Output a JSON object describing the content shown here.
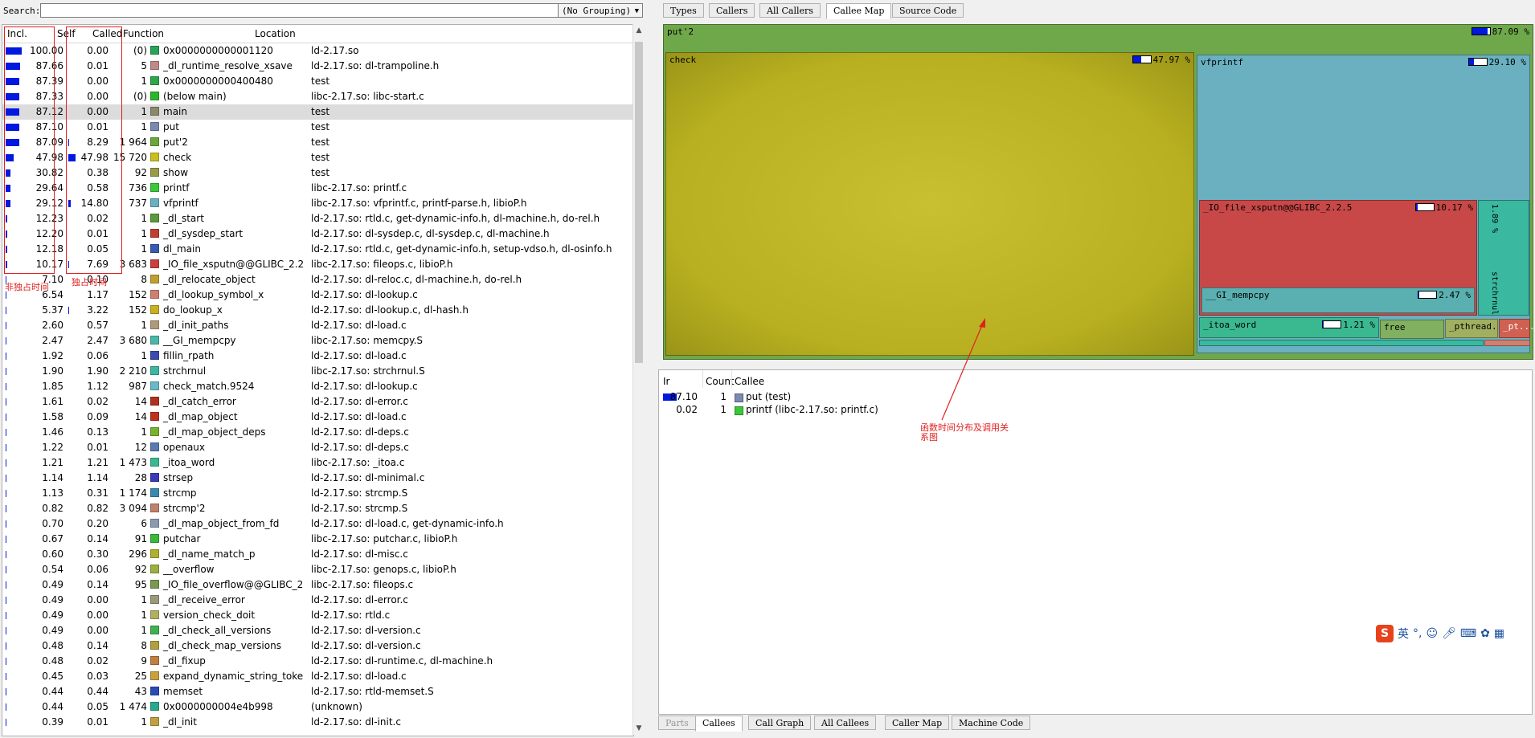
{
  "search": {
    "label": "Search:",
    "value": "",
    "grouping": "(No Grouping)"
  },
  "columns": {
    "incl": "Incl.",
    "self": "Self",
    "called": "Called",
    "function": "Function",
    "location": "Location"
  },
  "rows": [
    {
      "incl": "100.00",
      "self": "0.00",
      "called": "(0)",
      "fn": "0x0000000000001120",
      "loc": "ld-2.17.so",
      "color": "#27a35a"
    },
    {
      "incl": "87.66",
      "self": "0.01",
      "called": "5",
      "fn": "_dl_runtime_resolve_xsave",
      "loc": "ld-2.17.so: dl-trampoline.h",
      "color": "#c08a8a"
    },
    {
      "incl": "87.39",
      "self": "0.00",
      "called": "1",
      "fn": "0x0000000000400480",
      "loc": "test",
      "color": "#2aa84a"
    },
    {
      "incl": "87.33",
      "self": "0.00",
      "called": "(0)",
      "fn": "(below main)",
      "loc": "libc-2.17.so: libc-start.c",
      "color": "#2ab82a"
    },
    {
      "incl": "87.12",
      "self": "0.00",
      "called": "1",
      "fn": "main",
      "loc": "test",
      "color": "#8a8a6a",
      "selected": true
    },
    {
      "incl": "87.10",
      "self": "0.01",
      "called": "1",
      "fn": "put",
      "loc": "test",
      "color": "#7a8ab0"
    },
    {
      "incl": "87.09",
      "self": "8.29",
      "called": "1 964",
      "fn": "put'2",
      "loc": "test",
      "color": "#6aa83a"
    },
    {
      "incl": "47.98",
      "self": "47.98",
      "called": "15 720",
      "fn": "check",
      "loc": "test",
      "color": "#c8c020"
    },
    {
      "incl": "30.82",
      "self": "0.38",
      "called": "92",
      "fn": "show",
      "loc": "test",
      "color": "#9a9a4a"
    },
    {
      "incl": "29.64",
      "self": "0.58",
      "called": "736",
      "fn": "printf",
      "loc": "libc-2.17.so: printf.c",
      "color": "#3ac83a"
    },
    {
      "incl": "29.12",
      "self": "14.80",
      "called": "737",
      "fn": "vfprintf",
      "loc": "libc-2.17.so: vfprintf.c, printf-parse.h, libioP.h",
      "color": "#6ab0c0"
    },
    {
      "incl": "12.23",
      "self": "0.02",
      "called": "1",
      "fn": "_dl_start",
      "loc": "ld-2.17.so: rtld.c, get-dynamic-info.h, dl-machine.h, do-rel.h",
      "color": "#5a9a3a"
    },
    {
      "incl": "12.20",
      "self": "0.01",
      "called": "1",
      "fn": "_dl_sysdep_start",
      "loc": "ld-2.17.so: dl-sysdep.c, dl-sysdep.c, dl-machine.h",
      "color": "#c04030"
    },
    {
      "incl": "12.18",
      "self": "0.05",
      "called": "1",
      "fn": "dl_main",
      "loc": "ld-2.17.so: rtld.c, get-dynamic-info.h, setup-vdso.h, dl-osinfo.h",
      "color": "#3a5ab0"
    },
    {
      "incl": "10.17",
      "self": "7.69",
      "called": "3 683",
      "fn": "_IO_file_xsputn@@GLIBC_2.2.5",
      "loc": "libc-2.17.so: fileops.c, libioP.h",
      "color": "#c84040"
    },
    {
      "incl": "7.10",
      "self": "0.10",
      "called": "8",
      "fn": "_dl_relocate_object",
      "loc": "ld-2.17.so: dl-reloc.c, dl-machine.h, do-rel.h",
      "color": "#c0a030"
    },
    {
      "incl": "6.54",
      "self": "1.17",
      "called": "152",
      "fn": "_dl_lookup_symbol_x",
      "loc": "ld-2.17.so: dl-lookup.c",
      "color": "#d08070"
    },
    {
      "incl": "5.37",
      "self": "3.22",
      "called": "152",
      "fn": "do_lookup_x",
      "loc": "ld-2.17.so: dl-lookup.c, dl-hash.h",
      "color": "#c8b020"
    },
    {
      "incl": "2.60",
      "self": "0.57",
      "called": "1",
      "fn": "_dl_init_paths",
      "loc": "ld-2.17.so: dl-load.c",
      "color": "#b09a7a"
    },
    {
      "incl": "2.47",
      "self": "2.47",
      "called": "3 680",
      "fn": "__GI_mempcpy",
      "loc": "libc-2.17.so: memcpy.S",
      "color": "#4ab8a8"
    },
    {
      "incl": "1.92",
      "self": "0.06",
      "called": "1",
      "fn": "fillin_rpath",
      "loc": "ld-2.17.so: dl-load.c",
      "color": "#3a4ab0"
    },
    {
      "incl": "1.90",
      "self": "1.90",
      "called": "2 210",
      "fn": "strchrnul",
      "loc": "libc-2.17.so: strchrnul.S",
      "color": "#3ab8a0"
    },
    {
      "incl": "1.85",
      "self": "1.12",
      "called": "987",
      "fn": "check_match.9524",
      "loc": "ld-2.17.so: dl-lookup.c",
      "color": "#6ab8c8"
    },
    {
      "incl": "1.61",
      "self": "0.02",
      "called": "14",
      "fn": "_dl_catch_error",
      "loc": "ld-2.17.so: dl-error.c",
      "color": "#b03020"
    },
    {
      "incl": "1.58",
      "self": "0.09",
      "called": "14",
      "fn": "_dl_map_object",
      "loc": "ld-2.17.so: dl-load.c",
      "color": "#c03020"
    },
    {
      "incl": "1.46",
      "self": "0.13",
      "called": "1",
      "fn": "_dl_map_object_deps",
      "loc": "ld-2.17.so: dl-deps.c",
      "color": "#7ab030"
    },
    {
      "incl": "1.22",
      "self": "0.01",
      "called": "12",
      "fn": "openaux",
      "loc": "ld-2.17.so: dl-deps.c",
      "color": "#5a7ab0"
    },
    {
      "incl": "1.21",
      "self": "1.21",
      "called": "1 473",
      "fn": "_itoa_word",
      "loc": "libc-2.17.so: _itoa.c",
      "color": "#3ab890"
    },
    {
      "incl": "1.14",
      "self": "1.14",
      "called": "28",
      "fn": "strsep",
      "loc": "ld-2.17.so: dl-minimal.c",
      "color": "#3a3ab8"
    },
    {
      "incl": "1.13",
      "self": "0.31",
      "called": "1 174",
      "fn": "strcmp",
      "loc": "ld-2.17.so: strcmp.S",
      "color": "#3a8ab0"
    },
    {
      "incl": "0.82",
      "self": "0.82",
      "called": "3 094",
      "fn": "strcmp'2",
      "loc": "ld-2.17.so: strcmp.S",
      "color": "#c08070"
    },
    {
      "incl": "0.70",
      "self": "0.20",
      "called": "6",
      "fn": "_dl_map_object_from_fd",
      "loc": "ld-2.17.so: dl-load.c, get-dynamic-info.h",
      "color": "#8a9ab0"
    },
    {
      "incl": "0.67",
      "self": "0.14",
      "called": "91",
      "fn": "putchar",
      "loc": "libc-2.17.so: putchar.c, libioP.h",
      "color": "#3ab83a"
    },
    {
      "incl": "0.60",
      "self": "0.30",
      "called": "296",
      "fn": "_dl_name_match_p",
      "loc": "ld-2.17.so: dl-misc.c",
      "color": "#b0b030"
    },
    {
      "incl": "0.54",
      "self": "0.06",
      "called": "92",
      "fn": "__overflow",
      "loc": "libc-2.17.so: genops.c, libioP.h",
      "color": "#9ab040"
    },
    {
      "incl": "0.49",
      "self": "0.14",
      "called": "95",
      "fn": "_IO_file_overflow@@GLIBC_2...",
      "loc": "libc-2.17.so: fileops.c",
      "color": "#7a9a50"
    },
    {
      "incl": "0.49",
      "self": "0.00",
      "called": "1",
      "fn": "_dl_receive_error",
      "loc": "ld-2.17.so: dl-error.c",
      "color": "#9a9a7a"
    },
    {
      "incl": "0.49",
      "self": "0.00",
      "called": "1",
      "fn": "version_check_doit",
      "loc": "ld-2.17.so: rtld.c",
      "color": "#b0b060"
    },
    {
      "incl": "0.49",
      "self": "0.00",
      "called": "1",
      "fn": "_dl_check_all_versions",
      "loc": "ld-2.17.so: dl-version.c",
      "color": "#40b050"
    },
    {
      "incl": "0.48",
      "self": "0.14",
      "called": "8",
      "fn": "_dl_check_map_versions",
      "loc": "ld-2.17.so: dl-version.c",
      "color": "#b0a040"
    },
    {
      "incl": "0.48",
      "self": "0.02",
      "called": "9",
      "fn": "_dl_fixup",
      "loc": "ld-2.17.so: dl-runtime.c, dl-machine.h",
      "color": "#c08040"
    },
    {
      "incl": "0.45",
      "self": "0.03",
      "called": "25",
      "fn": "expand_dynamic_string_token",
      "loc": "ld-2.17.so: dl-load.c",
      "color": "#c8a040"
    },
    {
      "incl": "0.44",
      "self": "0.44",
      "called": "43",
      "fn": "memset",
      "loc": "ld-2.17.so: rtld-memset.S",
      "color": "#2a4ab8"
    },
    {
      "incl": "0.44",
      "self": "0.05",
      "called": "1 474",
      "fn": "0x0000000004e4b998",
      "loc": "(unknown)",
      "color": "#2aa88a"
    },
    {
      "incl": "0.39",
      "self": "0.01",
      "called": "1",
      "fn": "_dl_init",
      "loc": "ld-2.17.so: dl-init.c",
      "color": "#c0a040"
    }
  ],
  "annotations": {
    "incl_note": "非独占时间",
    "self_note": "独占时间",
    "map_note_line1": "函数时间分布及调用关",
    "map_note_line2": "系图"
  },
  "top_tabs": [
    "Types",
    "Callers",
    "All Callers",
    "Callee Map",
    "Source Code"
  ],
  "top_tab_active": "Callee Map",
  "treemap": {
    "root": {
      "name": "put'2",
      "pct": "87.09 %",
      "fill": 0.87
    },
    "check": {
      "name": "check",
      "pct": "47.97 %",
      "fill": 0.48
    },
    "vfprintf": {
      "name": "vfprintf",
      "pct": "29.10 %",
      "fill": 0.29
    },
    "xsputn": {
      "name": "_IO_file_xsputn@@GLIBC_2.2.5",
      "pct": "10.17 %",
      "fill": 0.1
    },
    "mempcpy": {
      "name": "__GI_mempcpy",
      "pct": "2.47 %",
      "fill": 0.05
    },
    "strchrnul": {
      "name": "strchrnul",
      "pct": "1.89 %"
    },
    "itoa": {
      "name": "_itoa_word",
      "pct": "1.21 %",
      "fill": 0.05
    },
    "free": {
      "name": "free"
    },
    "pthread": {
      "name": "_pthread..."
    },
    "pt": {
      "name": "_pt..."
    }
  },
  "callees": {
    "columns": {
      "ir": "Ir",
      "count": "Count",
      "callee": "Callee"
    },
    "rows": [
      {
        "ir": "87.10",
        "count": "1",
        "callee": "put (test)",
        "color": "#7a8ab0"
      },
      {
        "ir": "0.02",
        "count": "1",
        "callee": "printf (libc-2.17.so: printf.c)",
        "color": "#3ac83a"
      }
    ]
  },
  "bottom_tabs": [
    "Parts",
    "Callees",
    "Call Graph",
    "All Callees",
    "Caller Map",
    "Machine Code"
  ],
  "bottom_tab_active": "Callees",
  "bottom_tab_disabled": "Parts",
  "ime": {
    "logo": "S",
    "lang": "英"
  }
}
